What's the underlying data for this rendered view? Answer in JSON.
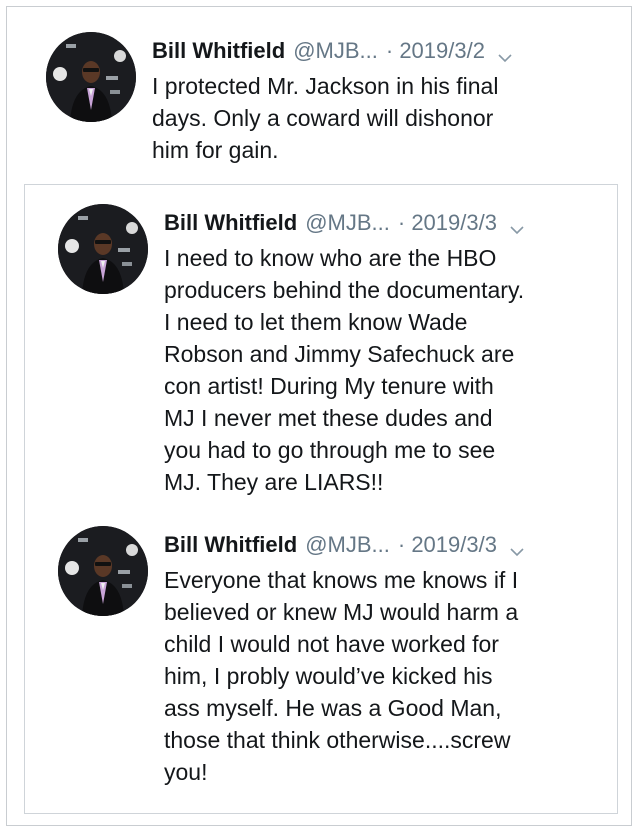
{
  "tweets": [
    {
      "name": "Bill Whitfield",
      "handle": "@MJB...",
      "date": "· 2019/3/2",
      "text": "I protected Mr. Jackson in his final\ndays. Only a coward will dishonor\nhim for gain."
    },
    {
      "name": "Bill Whitfield",
      "handle": "@MJB...",
      "date": "· 2019/3/3",
      "text": "I need to know who are the HBO\nproducers behind the documentary.\nI need to let them know Wade\nRobson and Jimmy Safechuck are\ncon artist! During My tenure with\nMJ I never met these dudes and\nyou had to go through me to see\nMJ. They are LIARS!!"
    },
    {
      "name": "Bill Whitfield",
      "handle": "@MJB...",
      "date": "· 2019/3/3",
      "text": "Everyone that knows me knows if I\nbelieved or knew MJ would harm a\nchild I would not have worked for\nhim, I probly would’ve kicked his\nass myself. He was a Good Man,\nthose that think otherwise....screw\nyou!"
    }
  ],
  "icons": {
    "menu": "chevron-down-icon",
    "avatar": "profile-photo"
  },
  "colors": {
    "text": "#14171a",
    "secondary": "#657786",
    "border": "#cfd4d9"
  }
}
